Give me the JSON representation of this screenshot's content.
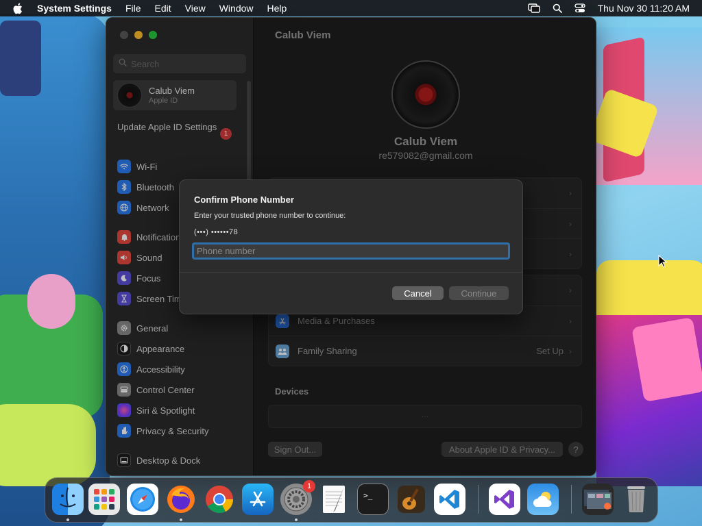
{
  "menubar": {
    "app_name": "System Settings",
    "items": [
      "File",
      "Edit",
      "View",
      "Window",
      "Help"
    ],
    "clock": "Thu Nov 30  11:20 AM"
  },
  "sidebar": {
    "search_placeholder": "Search",
    "account": {
      "name": "Calub Viem",
      "subtitle": "Apple ID"
    },
    "update_label": "Update Apple ID Settings",
    "update_badge": "1",
    "items": [
      {
        "label": "Wi-Fi",
        "icon": "wifi-icon",
        "color": "#2d7bf0"
      },
      {
        "label": "Bluetooth",
        "icon": "bluetooth-icon",
        "color": "#2d7bf0"
      },
      {
        "label": "Network",
        "icon": "globe-icon",
        "color": "#2d7bf0"
      },
      {
        "label": "Notifications",
        "icon": "bell-icon",
        "color": "#e5483f"
      },
      {
        "label": "Sound",
        "icon": "speaker-icon",
        "color": "#e5483f"
      },
      {
        "label": "Focus",
        "icon": "moon-icon",
        "color": "#5b4fd6"
      },
      {
        "label": "Screen Time",
        "icon": "hourglass-icon",
        "color": "#5b4fd6"
      },
      {
        "label": "General",
        "icon": "gear-icon",
        "color": "#8a8a8a"
      },
      {
        "label": "Appearance",
        "icon": "appearance-icon",
        "color": "#1c1c1c"
      },
      {
        "label": "Accessibility",
        "icon": "accessibility-icon",
        "color": "#2d7bf0"
      },
      {
        "label": "Control Center",
        "icon": "control-center-icon",
        "color": "#8a8a8a"
      },
      {
        "label": "Siri & Spotlight",
        "icon": "siri-icon",
        "color": "#c03ad8"
      },
      {
        "label": "Privacy & Security",
        "icon": "hand-icon",
        "color": "#2d7bf0"
      },
      {
        "label": "Desktop & Dock",
        "icon": "dock-icon",
        "color": "#1c1c1c"
      }
    ]
  },
  "main": {
    "title": "Calub Viem",
    "profile_name": "Calub Viem",
    "email": "re579082@gmail.com",
    "media_label": "Media & Purchases",
    "family_label": "Family Sharing",
    "family_value": "Set Up",
    "devices_title": "Devices",
    "devices_placeholder": "···",
    "sign_out": "Sign Out...",
    "about": "About Apple ID & Privacy...",
    "help": "?"
  },
  "dialog": {
    "title": "Confirm Phone Number",
    "message": "Enter your trusted phone number to continue:",
    "masked_number": "(•••) ••••••78",
    "input_placeholder": "Phone number",
    "cancel": "Cancel",
    "continue": "Continue"
  },
  "dock": {
    "settings_badge": "1",
    "apps": [
      "Finder",
      "Launchpad",
      "Safari",
      "Firefox",
      "Chrome",
      "App Store",
      "System Settings",
      "TextEdit",
      "Terminal",
      "GarageBand",
      "Visual Studio Code",
      "Visual Studio",
      "Weather",
      "Downloads",
      "Trash"
    ]
  }
}
